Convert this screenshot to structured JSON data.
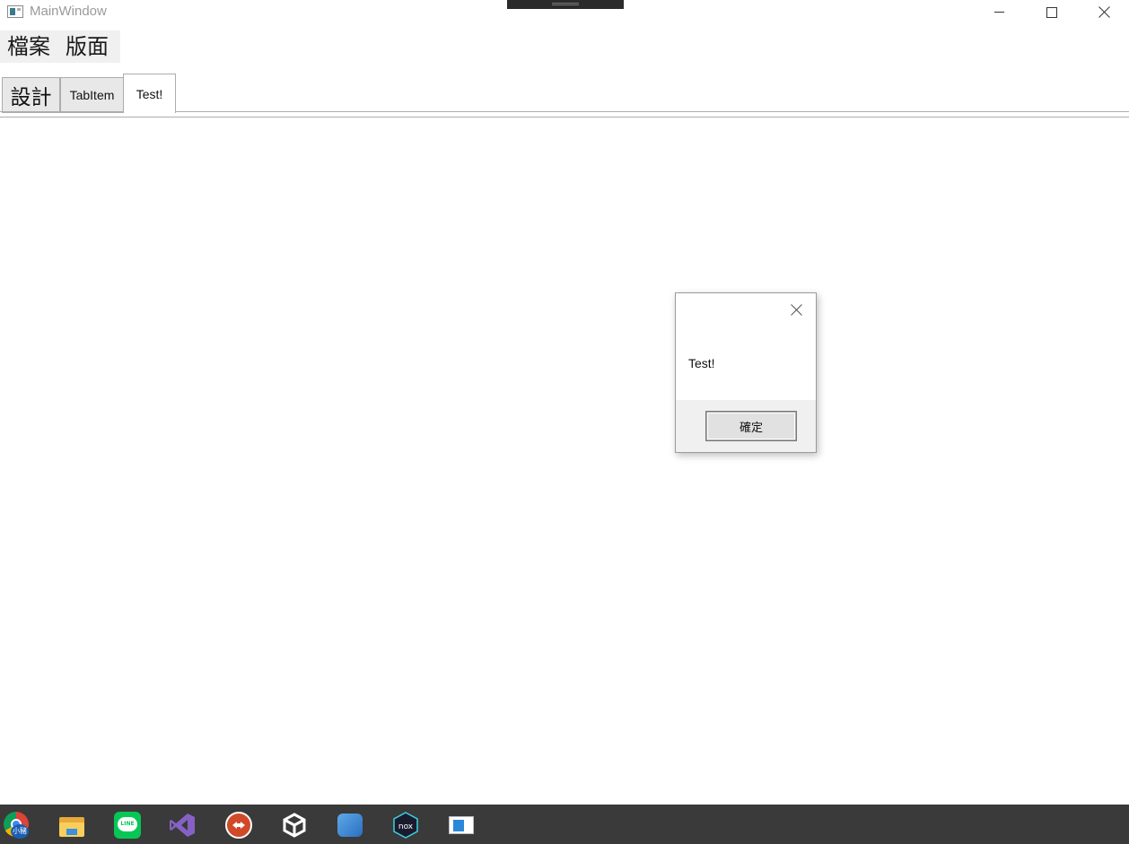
{
  "window": {
    "title": "MainWindow"
  },
  "menu": {
    "items": [
      "檔案",
      "版面"
    ]
  },
  "tabs": [
    {
      "label": "設計"
    },
    {
      "label": "TabItem"
    },
    {
      "label": "Test!"
    }
  ],
  "dialog": {
    "message": "Test!",
    "ok_label": "確定"
  },
  "taskbar": {
    "chrome_badge": "小豬",
    "line_label": "LINE",
    "nox_label": "nox",
    "apps": [
      "chrome-icon",
      "file-explorer-icon",
      "line-icon",
      "visual-studio-icon",
      "teamviewer-icon",
      "unity-icon",
      "app-icon",
      "nox-icon",
      "window-app-icon"
    ]
  },
  "colors": {
    "taskbar_bg": "#3a3a3a",
    "tab_selected_bg": "#ffffff",
    "tab_bg": "#e8e8e8",
    "menu_bg": "#f0f0f0"
  }
}
